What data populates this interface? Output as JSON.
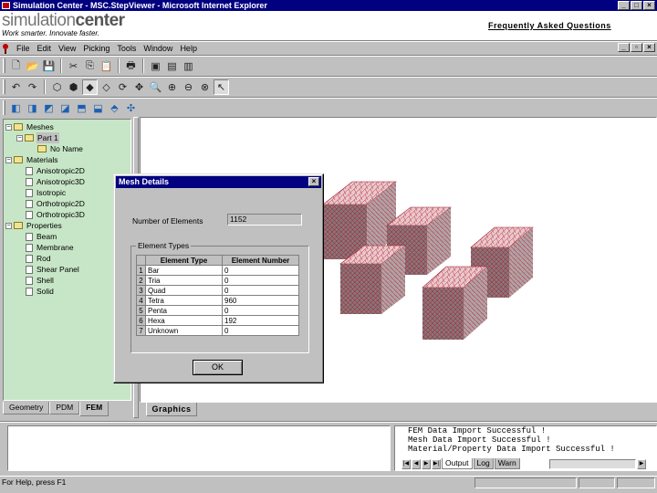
{
  "window": {
    "title": "Simulation Center - MSC.StepViewer - Microsoft Internet Explorer",
    "controls": [
      "minimize",
      "maximize",
      "close"
    ]
  },
  "banner": {
    "logo_part1": "simulation",
    "logo_part2": "center",
    "tagline": "Work smarter. Innovate faster.",
    "faq_link": "Frequently Asked Questions"
  },
  "menu": {
    "items": [
      "File",
      "Edit",
      "View",
      "Picking",
      "Tools",
      "Window",
      "Help"
    ]
  },
  "toolbars": {
    "row1_icons": [
      "new-icon",
      "open-icon",
      "save-icon",
      "cut-icon",
      "copy-icon",
      "paste-icon",
      "print-icon",
      "view-icon",
      "view2-icon",
      "view3-icon"
    ],
    "row2_icons": [
      "undo-icon",
      "redo-icon",
      "select-icon",
      "pick-icon",
      "shaded-icon",
      "wireframe-icon",
      "rotate-icon",
      "pan-icon",
      "zoom-icon",
      "zoom-in-icon",
      "zoom-out-icon",
      "zoom-box-icon",
      "pointer-icon"
    ],
    "row3_icons": [
      "front-view-icon",
      "back-view-icon",
      "left-view-icon",
      "right-view-icon",
      "top-view-icon",
      "bottom-view-icon",
      "iso-view-icon",
      "fit-icon"
    ]
  },
  "tree": {
    "nodes": [
      {
        "label": "Meshes",
        "level": 0,
        "type": "folder",
        "expander": "-"
      },
      {
        "label": "Part 1",
        "level": 1,
        "type": "folder",
        "expander": "-",
        "selected": true
      },
      {
        "label": "No Name",
        "level": 2,
        "type": "folder",
        "expander": ""
      },
      {
        "label": "Materials",
        "level": 0,
        "type": "folder",
        "expander": "-"
      },
      {
        "label": "Anisotropic2D",
        "level": 1,
        "type": "leaf"
      },
      {
        "label": "Anisotropic3D",
        "level": 1,
        "type": "leaf"
      },
      {
        "label": "Isotropic",
        "level": 1,
        "type": "leaf"
      },
      {
        "label": "Orthotropic2D",
        "level": 1,
        "type": "leaf"
      },
      {
        "label": "Orthotropic3D",
        "level": 1,
        "type": "leaf"
      },
      {
        "label": "Properties",
        "level": 0,
        "type": "folder",
        "expander": "-"
      },
      {
        "label": "Beam",
        "level": 1,
        "type": "leaf"
      },
      {
        "label": "Membrane",
        "level": 1,
        "type": "leaf"
      },
      {
        "label": "Rod",
        "level": 1,
        "type": "leaf"
      },
      {
        "label": "Shear Panel",
        "level": 1,
        "type": "leaf"
      },
      {
        "label": "Shell",
        "level": 1,
        "type": "leaf"
      },
      {
        "label": "Solid",
        "level": 1,
        "type": "leaf"
      }
    ]
  },
  "left_tabs": [
    "Geometry",
    "PDM",
    "FEM"
  ],
  "left_tab_active": "FEM",
  "graphics_tab": "Graphics",
  "dialog": {
    "title": "Mesh Details",
    "num_elements_label": "Number of Elements",
    "num_elements_value": "1152",
    "group_label": "Element Types",
    "table_headers": [
      "Element Type",
      "Element Number"
    ],
    "rows": [
      {
        "n": "1",
        "type": "Bar",
        "count": "0"
      },
      {
        "n": "2",
        "type": "Tria",
        "count": "0"
      },
      {
        "n": "3",
        "type": "Quad",
        "count": "0"
      },
      {
        "n": "4",
        "type": "Tetra",
        "count": "960"
      },
      {
        "n": "5",
        "type": "Penta",
        "count": "0"
      },
      {
        "n": "6",
        "type": "Hexa",
        "count": "192"
      },
      {
        "n": "7",
        "type": "Unknown",
        "count": "0"
      }
    ],
    "ok_label": "OK"
  },
  "output": {
    "lines": [
      "FEM Data Import Successful !",
      "Mesh Data Import Successful !",
      "Material/Property Data Import Successful !"
    ],
    "tabs": [
      "Output",
      "Log",
      "Warn"
    ]
  },
  "status": {
    "text": "For Help, press F1"
  }
}
